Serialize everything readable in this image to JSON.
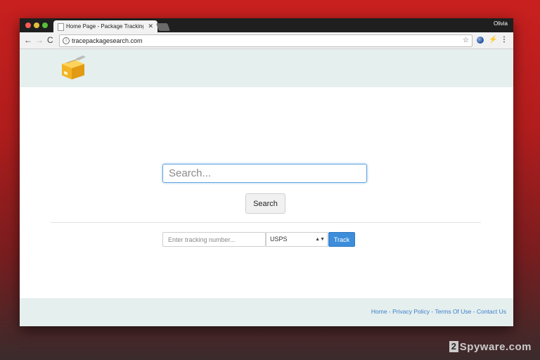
{
  "browser": {
    "tab_title": "Home Page - Package Tracking",
    "tab_close": "✕",
    "profile_name": "Olivia",
    "url": "tracepackagesearch.com",
    "nav_back": "←",
    "nav_forward": "→",
    "nav_reload": "C",
    "star": "☆",
    "info": "i",
    "menu": "⋮"
  },
  "search": {
    "placeholder": "Search...",
    "button_label": "Search"
  },
  "tracking": {
    "placeholder": "Enter tracking number...",
    "carrier_selected": "USPS",
    "select_arrow": "▲▼",
    "button_label": "Track"
  },
  "footer": {
    "links": [
      "Home",
      "Privacy Policy",
      "Terms Of Use",
      "Contact Us"
    ],
    "separator": " - "
  },
  "watermark": {
    "box_digit": "2",
    "text": "Spyware.com"
  },
  "colors": {
    "header_bg": "#e4efee",
    "accent": "#3d8ddb",
    "link": "#3e7ecb"
  },
  "icons": [
    "package-logo-icon",
    "info-icon",
    "star-icon",
    "extension-globe-icon",
    "extension-icon",
    "menu-icon"
  ]
}
